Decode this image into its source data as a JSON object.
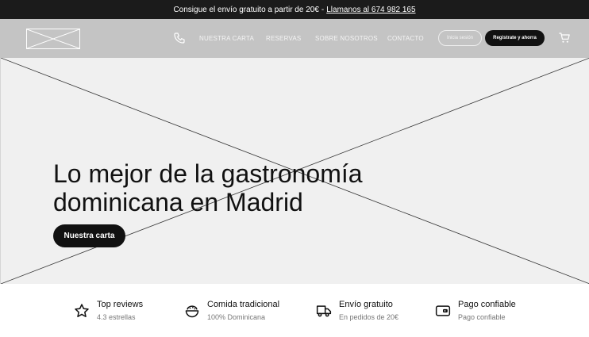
{
  "topbar": {
    "text": "Consigue el envío gratuito a partir de 20€",
    "separator": "-",
    "link": "Llamanos al 674 982 165"
  },
  "nav": {
    "links": [
      "NUESTRA CARTA",
      "RESERVAS",
      "SOBRE NOSOTROS",
      "CONTACTO"
    ],
    "login_label": "Inicia sesión",
    "register_label": "Registrate y ahorra"
  },
  "hero": {
    "title_line1": "Lo mejor de la gastronomía",
    "title_line2": "dominicana en Madrid",
    "button_label": "Nuestra carta"
  },
  "features": [
    {
      "icon": "star-icon",
      "title": "Top reviews",
      "subtitle": "4.3 estrellas"
    },
    {
      "icon": "food-bowl-icon",
      "title": "Comida tradicional",
      "subtitle": "100% Dominicana"
    },
    {
      "icon": "truck-icon",
      "title": "Envío gratuito",
      "subtitle": "En pedidos de 20€"
    },
    {
      "icon": "wallet-icon",
      "title": "Pago confiable",
      "subtitle": "Pago confiable"
    }
  ],
  "colors": {
    "topbar_bg": "#1b1b1b",
    "nav_bg": "#c4c4c4",
    "hero_bg": "#f0f0f0",
    "primary_button": "#111111"
  }
}
